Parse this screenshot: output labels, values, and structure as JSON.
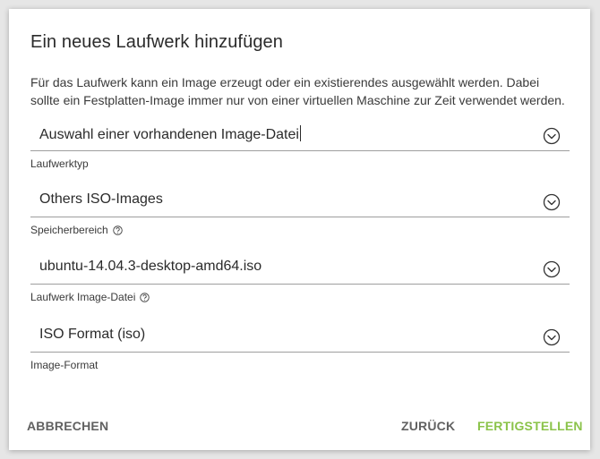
{
  "dialog": {
    "title": "Ein neues Laufwerk hinzufügen",
    "description": "Für das Laufwerk kann ein Image erzeugt oder ein existierendes ausgewählt werden. Dabei sollte ein Festplatten-Image immer nur von einer virtuellen Maschine zur Zeit verwendet werden."
  },
  "fields": {
    "drive_type": {
      "value": "Auswahl einer vorhandenen Image-Datei",
      "label": "Laufwerktyp"
    },
    "storage": {
      "value": "Others ISO-Images",
      "label": "Speicherbereich"
    },
    "image_file": {
      "value": "ubuntu-14.04.3-desktop-amd64.iso",
      "label": "Laufwerk Image-Datei"
    },
    "image_format": {
      "value": "ISO Format (iso)",
      "label": "Image-Format"
    }
  },
  "actions": {
    "cancel": "ABBRECHEN",
    "back": "ZURÜCK",
    "finish": "FERTIGSTELLEN"
  },
  "icons": {
    "dropdown": "chevron-down-circle-icon",
    "help": "help-circle-icon"
  },
  "colors": {
    "accent": "#8bc34a",
    "button_text": "#616161",
    "underline": "#9e9e9e"
  }
}
